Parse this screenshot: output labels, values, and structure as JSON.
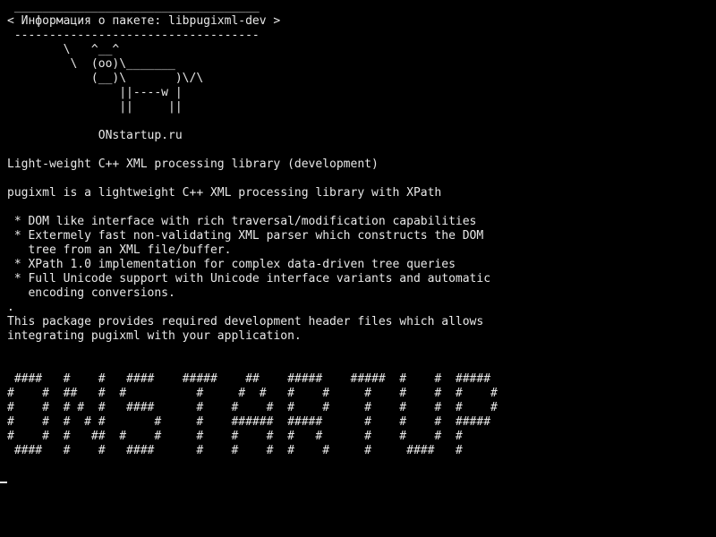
{
  "terminal": {
    "lines": [
      " ___________________________________",
      "< Информация о пакете: libpugixml-dev >",
      " -----------------------------------",
      "        \\   ^__^",
      "         \\  (oo)\\_______",
      "            (__)\\       )\\/\\",
      "                ||----w |",
      "                ||     ||",
      "",
      "             ONstartup.ru",
      "",
      "Light-weight C++ XML processing library (development)",
      "",
      "pugixml is a lightweight C++ XML processing library with XPath",
      "",
      " * DOM like interface with rich traversal/modification capabilities",
      " * Extermely fast non-validating XML parser which constructs the DOM",
      "   tree from an XML file/buffer.",
      " * XPath 1.0 implementation for complex data-driven tree queries",
      " * Full Unicode support with Unicode interface variants and automatic",
      "   encoding conversions.",
      ".",
      "This package provides required development header files which allows",
      "integrating pugixml with your application.",
      "",
      "",
      " ####   #    #   ####    #####    ##    #####    #####  #    #  #####",
      "#    #  ##   #  #          #     #  #   #    #     #    #    #  #    #",
      "#    #  # #  #   ####      #    #    #  #    #     #    #    #  #    #",
      "#    #  #  # #       #     #    ######  #####      #    #    #  #####",
      "#    #  #   ##  #    #     #    #    #  #   #      #    #    #  #",
      " ####   #    #   ####      #    #    #  #    #     #     ####   #"
    ]
  }
}
